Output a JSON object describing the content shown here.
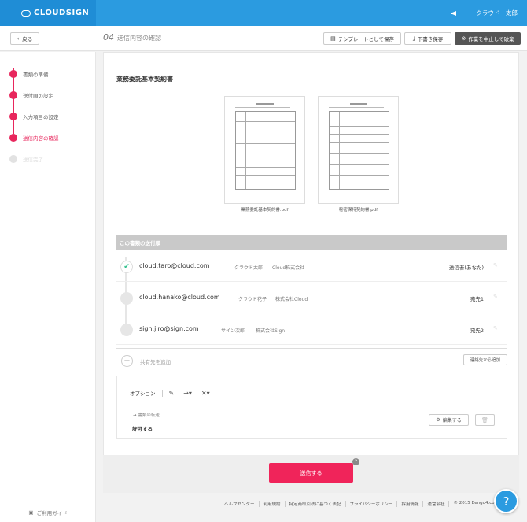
{
  "app": {
    "logo_text": "CLOUDSIGN",
    "user_name": "クラウド　太郎"
  },
  "header": {
    "back_label": "戻る",
    "step_number": "04",
    "step_title": "送信内容の確認",
    "template_label": "テンプレートとして保存",
    "draft_label": "下書き保存",
    "abort_label": "作業を中止して破棄"
  },
  "sidebar": {
    "steps": [
      {
        "label": "書類の準備"
      },
      {
        "label": "送付順の設定"
      },
      {
        "label": "入力項目の設定"
      },
      {
        "label": "送信内容の確認"
      },
      {
        "label": "送信完了"
      }
    ],
    "guide_label": "ご利用ガイド"
  },
  "document": {
    "title": "業務委託基本契約書",
    "files": [
      {
        "name": "業務委託基本契約書.pdf"
      },
      {
        "name": "秘密保持契約書.pdf"
      }
    ]
  },
  "order": {
    "heading": "この書類の送付順",
    "signers": [
      {
        "email": "cloud.taro@cloud.com",
        "name": "クラウド太郎",
        "company": "Cloud株式会社",
        "role": "送信者(あなた)"
      },
      {
        "email": "cloud.hanako@cloud.com",
        "name": "クラウド花子",
        "company": "株式会社Cloud",
        "role": "宛先1"
      },
      {
        "email": "sign.jiro@sign.com",
        "name": "サイン次郎",
        "company": "株式会社Sign",
        "role": "宛先2"
      }
    ],
    "share_label": "共有先を追加",
    "contact_label": "連絡先から追加"
  },
  "options": {
    "label": "オプション",
    "forward_label": "書類の転送",
    "allow_label": "許可する",
    "edit_label": "編集する"
  },
  "send": {
    "label": "送信する",
    "help_mark": "?"
  },
  "footer": {
    "links": [
      "ヘルプセンター",
      "利用規約",
      "特定商取引法に基づく表記",
      "プライバシーポリシー",
      "採用情報",
      "運営会社",
      "© 2015 Bengo4.com, Inc."
    ]
  },
  "fab": {
    "label": "?"
  }
}
